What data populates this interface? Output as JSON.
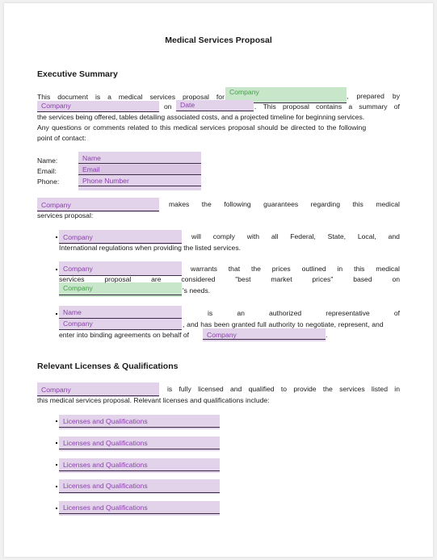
{
  "document": {
    "title": "Medical Services Proposal",
    "sections": {
      "executive_summary": {
        "heading": "Executive Summary",
        "intro": {
          "line1_start": [
            "This",
            "document",
            "is",
            "a",
            "medical",
            "services",
            "proposal",
            "for"
          ],
          "field_company_client": "Company",
          "line1_end": ", prepared by",
          "field_company_provider": "Company",
          "word_on": "on",
          "field_date": "Date",
          "line2_end": ". This proposal contains a summary of",
          "line3": "the services being offered, tables detailing associated costs, and a projected timeline for beginning services.",
          "line4": "Any questions or comments related to this medical services proposal should be directed to the following",
          "line5": "point of contact:"
        },
        "contact": {
          "name_label": "Name:",
          "email_label": "Email:",
          "phone_label": "Phone:",
          "name_field": "Name",
          "email_field": "Email",
          "phone_field": "Phone Number"
        },
        "guarantees": {
          "field_company": "Company",
          "line1_words": [
            "makes",
            "the",
            "following",
            "guarantees",
            "regarding",
            "this",
            "medical"
          ],
          "line2": "services proposal:",
          "items": [
            {
              "field_company": "Company",
              "line1_words": [
                "will",
                "comply",
                "with",
                "all",
                "Federal,",
                "State,",
                "Local,",
                "and"
              ],
              "line2": "International regulations when providing the listed services."
            },
            {
              "field_company": "Company",
              "line1_words": [
                "warrants",
                "that",
                "the",
                "prices",
                "outlined",
                "in",
                "this",
                "medical"
              ],
              "line2_words": [
                "services",
                "proposal",
                "are",
                "considered",
                "\"best",
                "market",
                "prices\"",
                "based",
                "on"
              ],
              "field_company_client": "Company",
              "line3_end": "'s needs."
            },
            {
              "field_name": "Name",
              "line1_words": [
                "is",
                "an",
                "authorized",
                "representative",
                "of"
              ],
              "field_company": "Company",
              "line2_end": ", and has been granted full authority to negotiate, represent, and",
              "line3_start": "enter into binding agreements on behalf of",
              "field_company_end": "Company",
              "line3_end": "."
            }
          ]
        }
      },
      "licenses": {
        "heading": "Relevant Licenses & Qualifications",
        "field_company": "Company",
        "line1_words": [
          "is",
          "fully",
          "licensed",
          "and",
          "qualified",
          "to",
          "provide",
          "the",
          "services",
          "listed",
          "in"
        ],
        "line2": "this medical services proposal. Relevant licenses and qualifications include:",
        "items": [
          "Licenses and Qualifications",
          "Licenses and Qualifications",
          "Licenses and Qualifications",
          "Licenses and Qualifications",
          "Licenses and Qualifications"
        ]
      }
    }
  },
  "colors": {
    "provider_field_bg": "#e3d3ea",
    "provider_field_text": "#8a3fae",
    "client_field_bg": "#c8e6c9",
    "client_field_text": "#43a047"
  }
}
